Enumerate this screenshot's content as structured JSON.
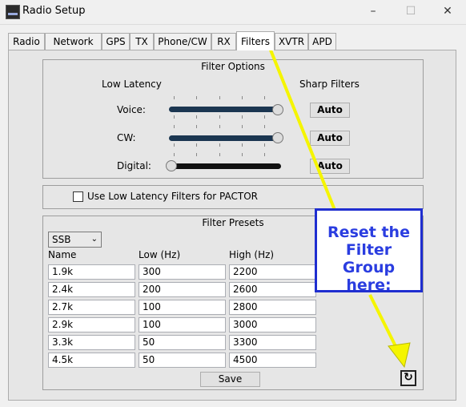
{
  "window": {
    "title": "Radio Setup",
    "minimize": "–",
    "maximize": "☐",
    "close": "✕"
  },
  "tabs": [
    "Radio",
    "Network",
    "GPS",
    "TX",
    "Phone/CW",
    "RX",
    "Filters",
    "XVTR",
    "APD"
  ],
  "active_tab": "Filters",
  "filter_options": {
    "title": "Filter Options",
    "low_latency_label": "Low Latency",
    "sharp_filters_label": "Sharp Filters",
    "rows": [
      {
        "label": "Voice:",
        "value": 1.0,
        "button": "Auto"
      },
      {
        "label": "CW:",
        "value": 1.0,
        "button": "Auto"
      },
      {
        "label": "Digital:",
        "value": 0.0,
        "button": "Auto"
      }
    ]
  },
  "pactor": {
    "label": "Use Low Latency Filters for PACTOR",
    "checked": false
  },
  "filter_presets": {
    "title": "Filter Presets",
    "mode": "SSB",
    "columns": [
      "Name",
      "Low (Hz)",
      "High (Hz)"
    ],
    "rows": [
      [
        "1.9k",
        "300",
        "2200"
      ],
      [
        "2.4k",
        "200",
        "2600"
      ],
      [
        "2.7k",
        "100",
        "2800"
      ],
      [
        "2.9k",
        "100",
        "3000"
      ],
      [
        "3.3k",
        "50",
        "3300"
      ],
      [
        "4.5k",
        "50",
        "4500"
      ]
    ],
    "save_label": "Save",
    "reset_icon": "refresh-icon"
  },
  "annotation": {
    "text_lines": [
      "Reset the",
      "Filter Group",
      "here:"
    ],
    "colors": {
      "box": "#1f2ed0",
      "arrow": "#f5f500"
    }
  }
}
